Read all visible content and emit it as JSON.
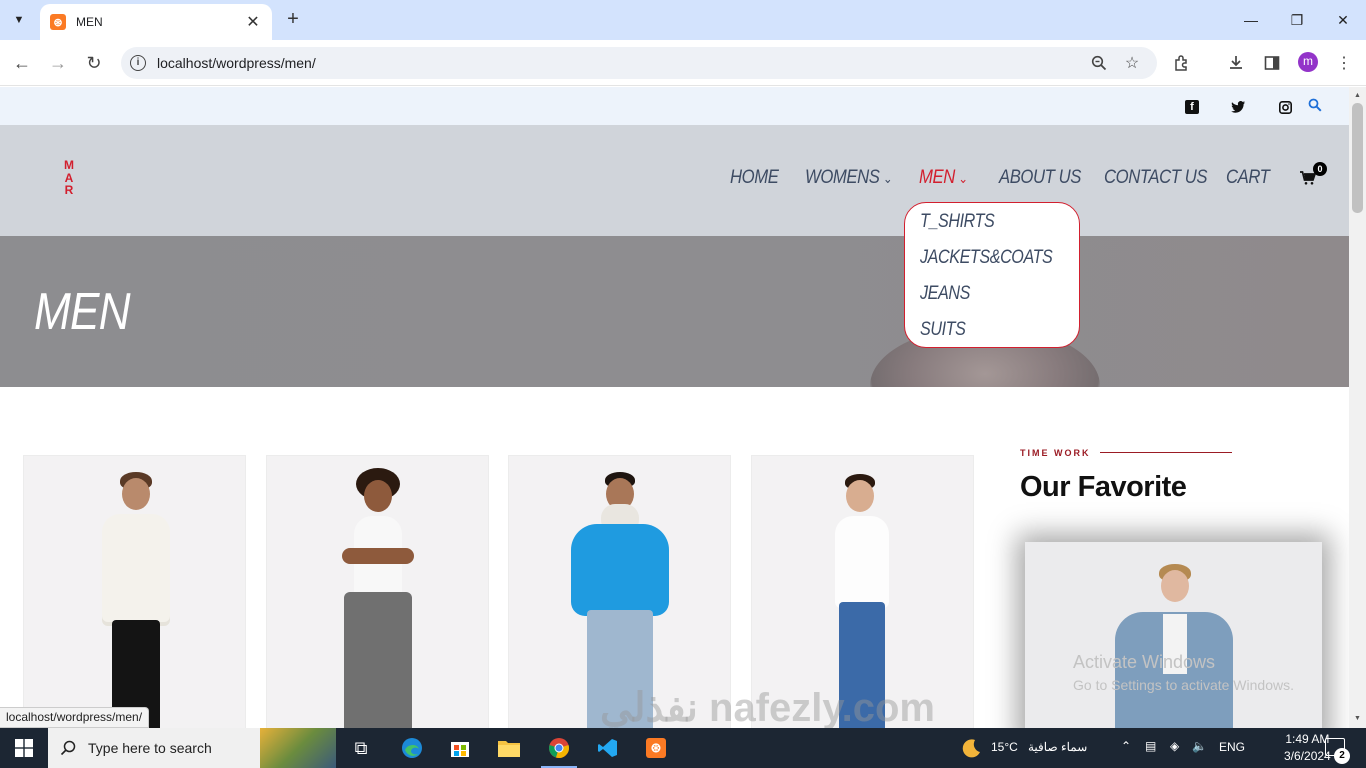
{
  "browser": {
    "tab_title": "MEN",
    "url": "localhost/wordpress/men/"
  },
  "site": {
    "logo_letters": [
      "M",
      "A",
      "R"
    ],
    "nav": [
      {
        "label": "HOME"
      },
      {
        "label": "WOMENS"
      },
      {
        "label": "MEN"
      },
      {
        "label": "ABOUT US"
      },
      {
        "label": "CONTACT US"
      },
      {
        "label": "CART"
      }
    ],
    "cart_count": "0",
    "dropdown": [
      "T_SHIRTS",
      "JACKETS&COATS",
      "JEANS",
      "SUITS"
    ],
    "hero_title": "MEN",
    "sidebar": {
      "label": "TIME WORK",
      "title": "Our Favorite"
    }
  },
  "overlay": {
    "activate_title": "Activate Windows",
    "activate_sub": "Go to Settings to activate Windows.",
    "watermark": "نفذلي nafezly.com",
    "status_url": "localhost/wordpress/men/"
  },
  "taskbar": {
    "search_placeholder": "Type here to search",
    "temperature": "15°C",
    "weather": "سماء صافية",
    "language": "ENG",
    "time": "1:49 AM",
    "date": "3/6/2024",
    "notifications": "2"
  },
  "colors": {
    "accent": "#d21f2e",
    "nav_text": "#3d4b63",
    "header_bg": "#d0d4da",
    "topbar_bg": "#edf3fb"
  }
}
